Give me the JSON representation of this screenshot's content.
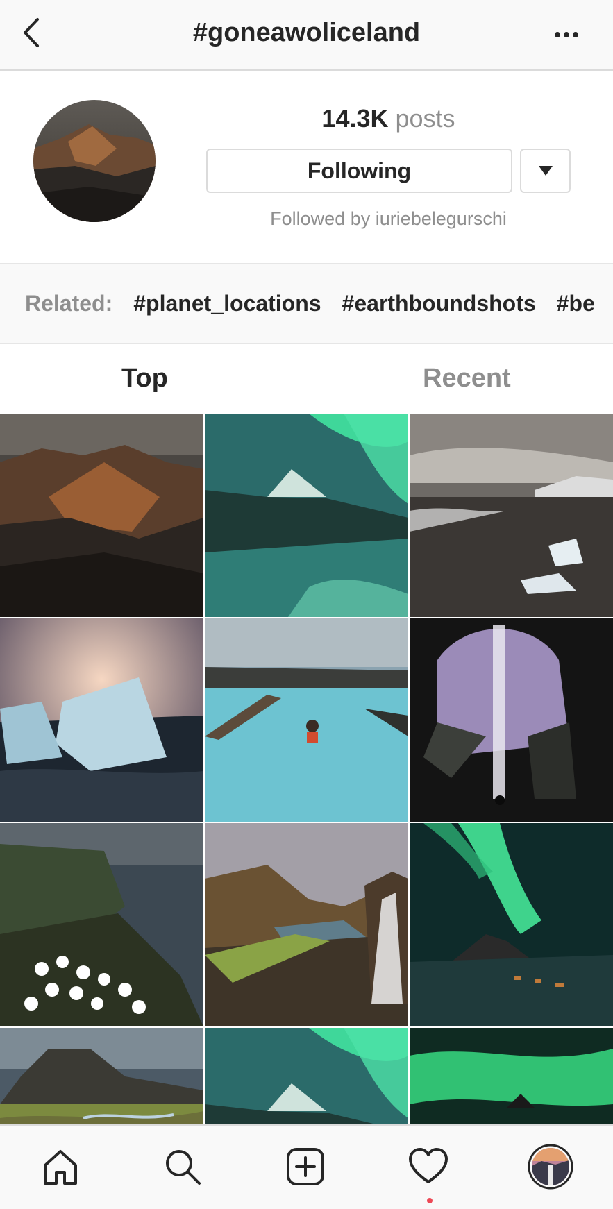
{
  "header": {
    "title": "#goneawoliceland",
    "back_icon": "chevron-left-icon",
    "more_icon": "ellipsis-icon"
  },
  "profile": {
    "posts_count": "14.3K",
    "posts_label": "posts",
    "follow_button_label": "Following",
    "dropdown_icon": "triangle-down-icon",
    "followed_by": "Followed by iuriebelegurschi"
  },
  "related": {
    "label": "Related:",
    "tags": [
      "#planet_locations",
      "#earthboundshots",
      "#be"
    ]
  },
  "tabs": {
    "top_label": "Top",
    "recent_label": "Recent",
    "active": "Top"
  },
  "grid": {
    "images": [
      "volcanic-mountains-photo",
      "aurora-kirkjufell-photo",
      "black-sand-beach-ice-photo",
      "glacier-ice-sunset-photo",
      "blue-lagoon-woman-photo",
      "cave-waterfall-photo",
      "daisies-coastal-cliffs-photo",
      "valley-waterfall-photo",
      "aurora-village-night-photo",
      "mountain-river-valley-photo",
      "aurora-kirkjufell-photo",
      "aurora-green-sky-photo"
    ]
  },
  "bottom_nav": {
    "items": [
      "home-icon",
      "search-icon",
      "new-post-icon",
      "heart-icon",
      "profile-avatar"
    ]
  },
  "colors": {
    "text_primary": "#262626",
    "text_secondary": "#8e8e8e",
    "border": "#dbdbdb",
    "notification": "#ed4956"
  }
}
